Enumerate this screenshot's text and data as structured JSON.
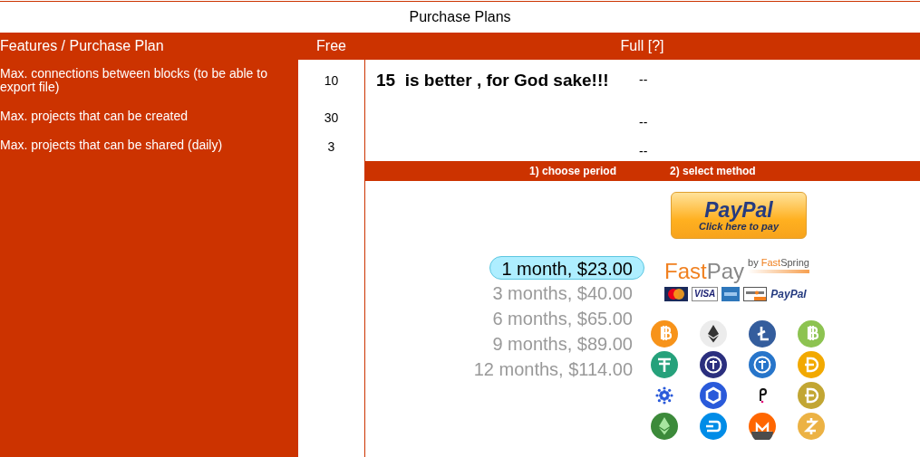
{
  "title": "Purchase Plans",
  "columns": [
    "Features / Purchase Plan",
    "Free",
    "Full [?]"
  ],
  "rows": [
    {
      "feature": "Max. connections between blocks (to be able to export file)",
      "free": "10",
      "note": "15  is better , for God sake!!!",
      "full": "--"
    },
    {
      "feature": "Max. projects that can be created",
      "free": "30",
      "full": "--"
    },
    {
      "feature": "Max. projects that can be shared (daily)",
      "free": "3",
      "full": "--"
    }
  ],
  "steps": [
    "1) choose period",
    "2) select method"
  ],
  "periods": [
    {
      "label": "1 month, $23.00",
      "selected": true
    },
    {
      "label": "3 months, $40.00",
      "selected": false
    },
    {
      "label": "6 months, $65.00",
      "selected": false
    },
    {
      "label": "9 months, $89.00",
      "selected": false
    },
    {
      "label": "12 months, $114.00",
      "selected": false
    }
  ],
  "paypal_button": {
    "logo": "PayPal",
    "caption": "Click here to pay"
  },
  "fastpay": {
    "logo_part_1": "Fast",
    "logo_part_2": "Pay",
    "by": "by",
    "brand_part_1": "Fast",
    "brand_part_2": "Spring"
  },
  "cards": [
    {
      "kind": "mastercard"
    },
    {
      "kind": "visa",
      "label": "VISA"
    },
    {
      "kind": "amex"
    },
    {
      "kind": "discover"
    },
    {
      "kind": "paypal",
      "label": "PayPal"
    }
  ],
  "coins": [
    {
      "kind": "b",
      "color": "#f7931a"
    },
    {
      "kind": "diamond",
      "color": "#ececec"
    },
    {
      "kind": "l",
      "color": "#345d9d"
    },
    {
      "kind": "b",
      "color": "#8dc351"
    },
    {
      "kind": "t",
      "color": "#26a17b"
    },
    {
      "kind": "ring",
      "color": "#2b2f7e"
    },
    {
      "kind": "ring",
      "color": "#2775ca"
    },
    {
      "kind": "d",
      "color": "#f2a900"
    },
    {
      "kind": "dots",
      "color": "#2a5ada"
    },
    {
      "kind": "hex",
      "color": "#2a5ada"
    },
    {
      "kind": "p",
      "color": "#111111"
    },
    {
      "kind": "d",
      "color": "#c2a633"
    },
    {
      "kind": "diamond",
      "color": "#3c8a3a"
    },
    {
      "kind": "dash",
      "color": "#008ce7"
    },
    {
      "kind": "m",
      "color": "#ff6600"
    },
    {
      "kind": "z",
      "color": "#ecb244"
    }
  ]
}
